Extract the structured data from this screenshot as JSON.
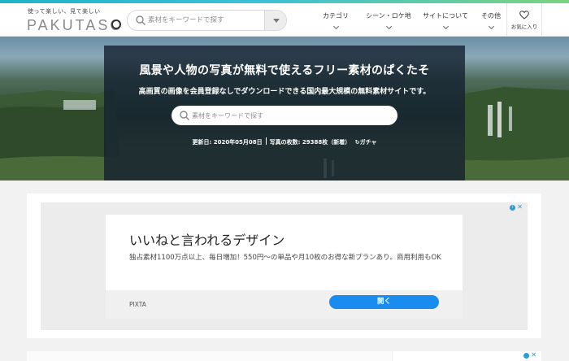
{
  "header": {
    "logo_tagline": "使って楽しい、見て楽しい",
    "logo_wordmark": "PAKUTASO",
    "search_placeholder": "素材をキーワードで探す",
    "nav": [
      {
        "label": "カテゴリ"
      },
      {
        "label": "シーン・ロケ地"
      },
      {
        "label": "サイトについて"
      },
      {
        "label": "その他"
      }
    ],
    "favorites_label": "お気に入り"
  },
  "hero": {
    "title": "風景や人物の写真が無料で使えるフリー素材のぱくたそ",
    "subtitle": "高画質の画像を会員登録なしでダウンロードできる国内最大規模の無料素材サイトです。",
    "search_placeholder": "素材をキーワードで探す",
    "updated": "更新日: 2020年05月08日",
    "photo_count": "写真の枚数: 29388枚（新着）",
    "gacha_label": "ガチャ"
  },
  "ad": {
    "title": "いいねと言われるデザイン",
    "description": "独占素材1100万点以上、毎日増加！550円〜の単品や月10枚のお得な新プランあり。商用利用もOK",
    "brand": "PIXTA",
    "button_label": "開く"
  },
  "colors": {
    "accent_gradient_start": "#1fb3c9",
    "accent_gradient_end": "#7bd37e",
    "ad_button": "#1a8cf0",
    "adchoices": "#2d9bd6"
  }
}
